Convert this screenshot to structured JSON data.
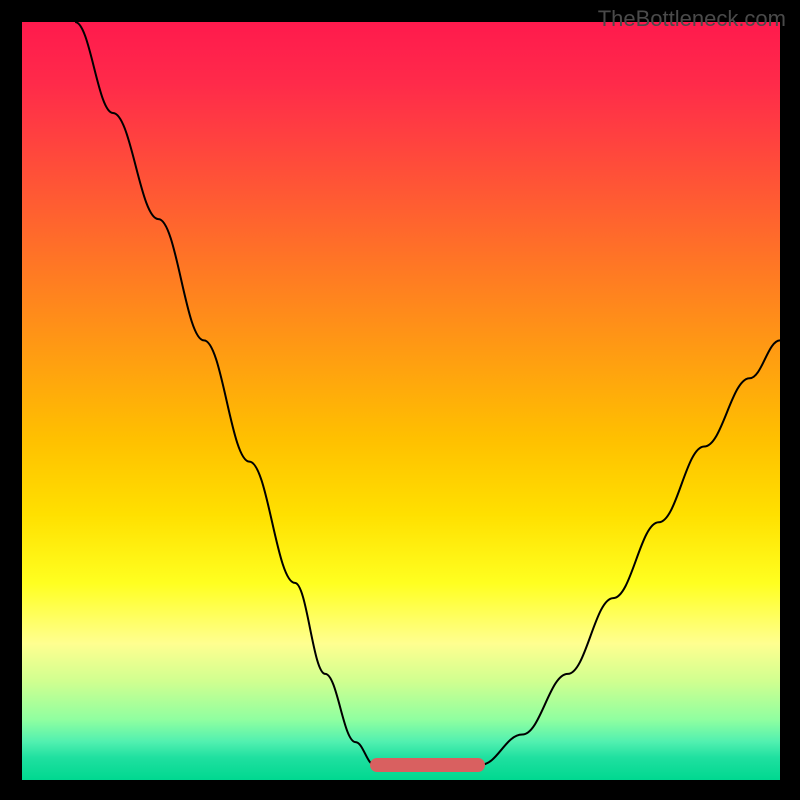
{
  "watermark": "TheBottleneck.com",
  "chart_data": {
    "type": "line",
    "title": "",
    "xlabel": "",
    "ylabel": "",
    "xlim": [
      0,
      100
    ],
    "ylim": [
      0,
      100
    ],
    "grid": false,
    "legend": false,
    "series": [
      {
        "name": "left-curve",
        "x": [
          7,
          12,
          18,
          24,
          30,
          36,
          40,
          44,
          46.5
        ],
        "y": [
          100,
          88,
          74,
          58,
          42,
          26,
          14,
          5,
          2
        ]
      },
      {
        "name": "flat-zone",
        "x": [
          46.5,
          60.5
        ],
        "y": [
          2,
          2
        ]
      },
      {
        "name": "right-curve",
        "x": [
          60.5,
          66,
          72,
          78,
          84,
          90,
          96,
          100
        ],
        "y": [
          2,
          6,
          14,
          24,
          34,
          44,
          53,
          58
        ]
      }
    ],
    "hot_zone": {
      "x_start": 46.5,
      "x_end": 60.5,
      "y": 2
    },
    "background_gradient": [
      "#ff1a4d",
      "#ffc000",
      "#ffff20",
      "#00d890"
    ]
  }
}
